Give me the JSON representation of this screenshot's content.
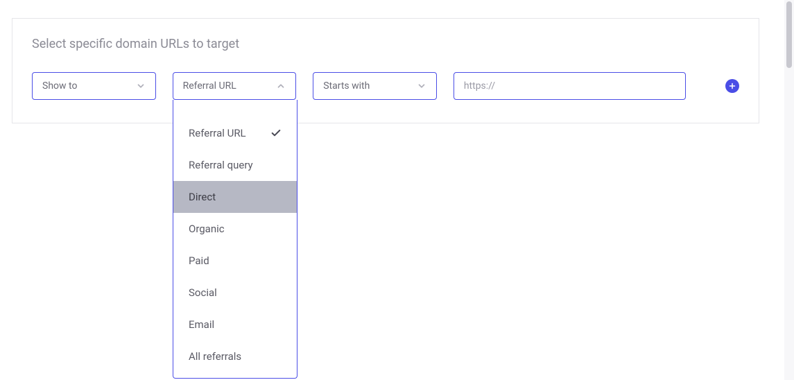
{
  "panel": {
    "title": "Select specific domain URLs to target"
  },
  "row": {
    "showTo": "Show to",
    "referralUrl": "Referral URL",
    "startsWith": "Starts with"
  },
  "input": {
    "placeholder": "https://"
  },
  "dropdown": {
    "items": [
      "Referral URL",
      "Referral query",
      "Direct",
      "Organic",
      "Paid",
      "Social",
      "Email",
      "All referrals"
    ],
    "selectedIndex": 0,
    "highlightedIndex": 2
  },
  "colors": {
    "accent": "#4a4de6",
    "chevron": "#b0b0ba"
  }
}
